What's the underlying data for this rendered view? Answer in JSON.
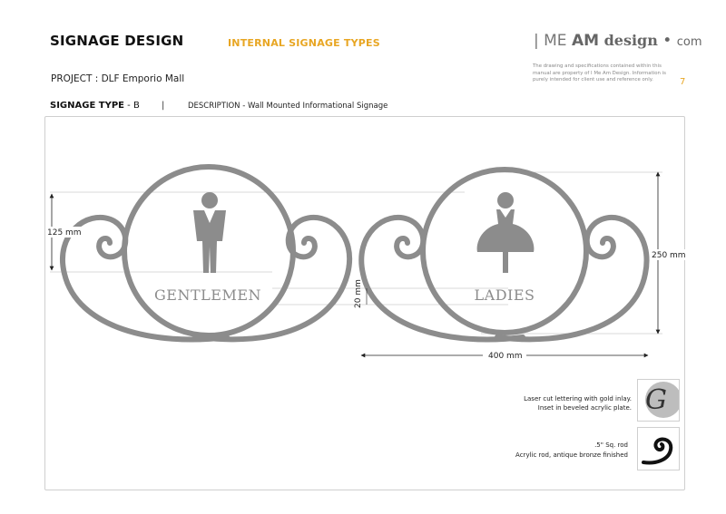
{
  "header": {
    "title": "SIGNAGE DESIGN",
    "subtitle": "INTERNAL SIGNAGE TYPES",
    "project": "PROJECT : DLF Emporio Mall",
    "signage_type_label": "SIGNAGE TYPE",
    "signage_type_value": " - B",
    "separator": "|",
    "description": "DESCRIPTION - Wall Mounted Informational Signage"
  },
  "brand": {
    "part1": "| ME ",
    "part2": "AM",
    "part3": " design",
    "part4": " • ",
    "part5": "com",
    "disclaimer": "The drawing and specifications contained within this manual are property of I Me Am Design. Information is purely intended for client use and reference only.",
    "page_number": "7"
  },
  "drawing": {
    "sign_left_label": "GENTLEMEN",
    "sign_right_label": "LADIES",
    "dim_height_small": "125 mm",
    "dim_height_total": "250 mm",
    "dim_width": "400 mm",
    "dim_text_height": "20 mm",
    "colors": {
      "sign": "#8c8c8c",
      "accent": "#e8a623",
      "frame": "#cfcfcf"
    }
  },
  "notes": {
    "lettering": "Laser cut lettering with gold inlay. Inset in beveled acrylic plate.",
    "rod_size": ".5\" Sq. rod",
    "rod": "Acrylic rod, antique bronze finished",
    "swatch_letter": "G"
  }
}
